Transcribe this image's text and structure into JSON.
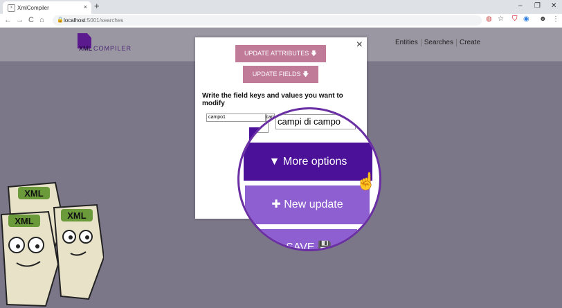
{
  "browser": {
    "tab_title": "XmlCompiler",
    "tab_favicon_label": "x",
    "tab_close": "×",
    "new_tab": "+",
    "controls": {
      "minimize": "–",
      "maximize": "❐",
      "close": "✕"
    },
    "nav": {
      "back": "←",
      "forward": "→",
      "reload": "C",
      "home": "⌂"
    },
    "url_host": "localhost",
    "url_path": ":5001/searches",
    "ext_icons": [
      "translate-icon",
      "star-icon",
      "shield-icon",
      "audio-icon",
      "account-icon",
      "menu-icon"
    ]
  },
  "site": {
    "logo_xml": "XML",
    "logo_compiler": "COMPILER",
    "nav": [
      "Entities",
      "Searches",
      "Create"
    ]
  },
  "modal": {
    "close": "×",
    "update_attributes": "UPDATE ATTRIBUTES 🡇",
    "update_fields": "UPDATE FIELDS 🡇",
    "instructions": "Write the field keys and values you want to modify",
    "field_key_value": "campo1",
    "field_value_value": "campi di campo"
  },
  "magnifier": {
    "more_options": "More options",
    "new_update": "New update",
    "save": "SAVE"
  },
  "mascot": {
    "labels": [
      "XML",
      "XML",
      "XML"
    ]
  },
  "colors": {
    "accent": "#4b1299",
    "pink": "#c07b98",
    "lilac": "#8e5fd0"
  }
}
